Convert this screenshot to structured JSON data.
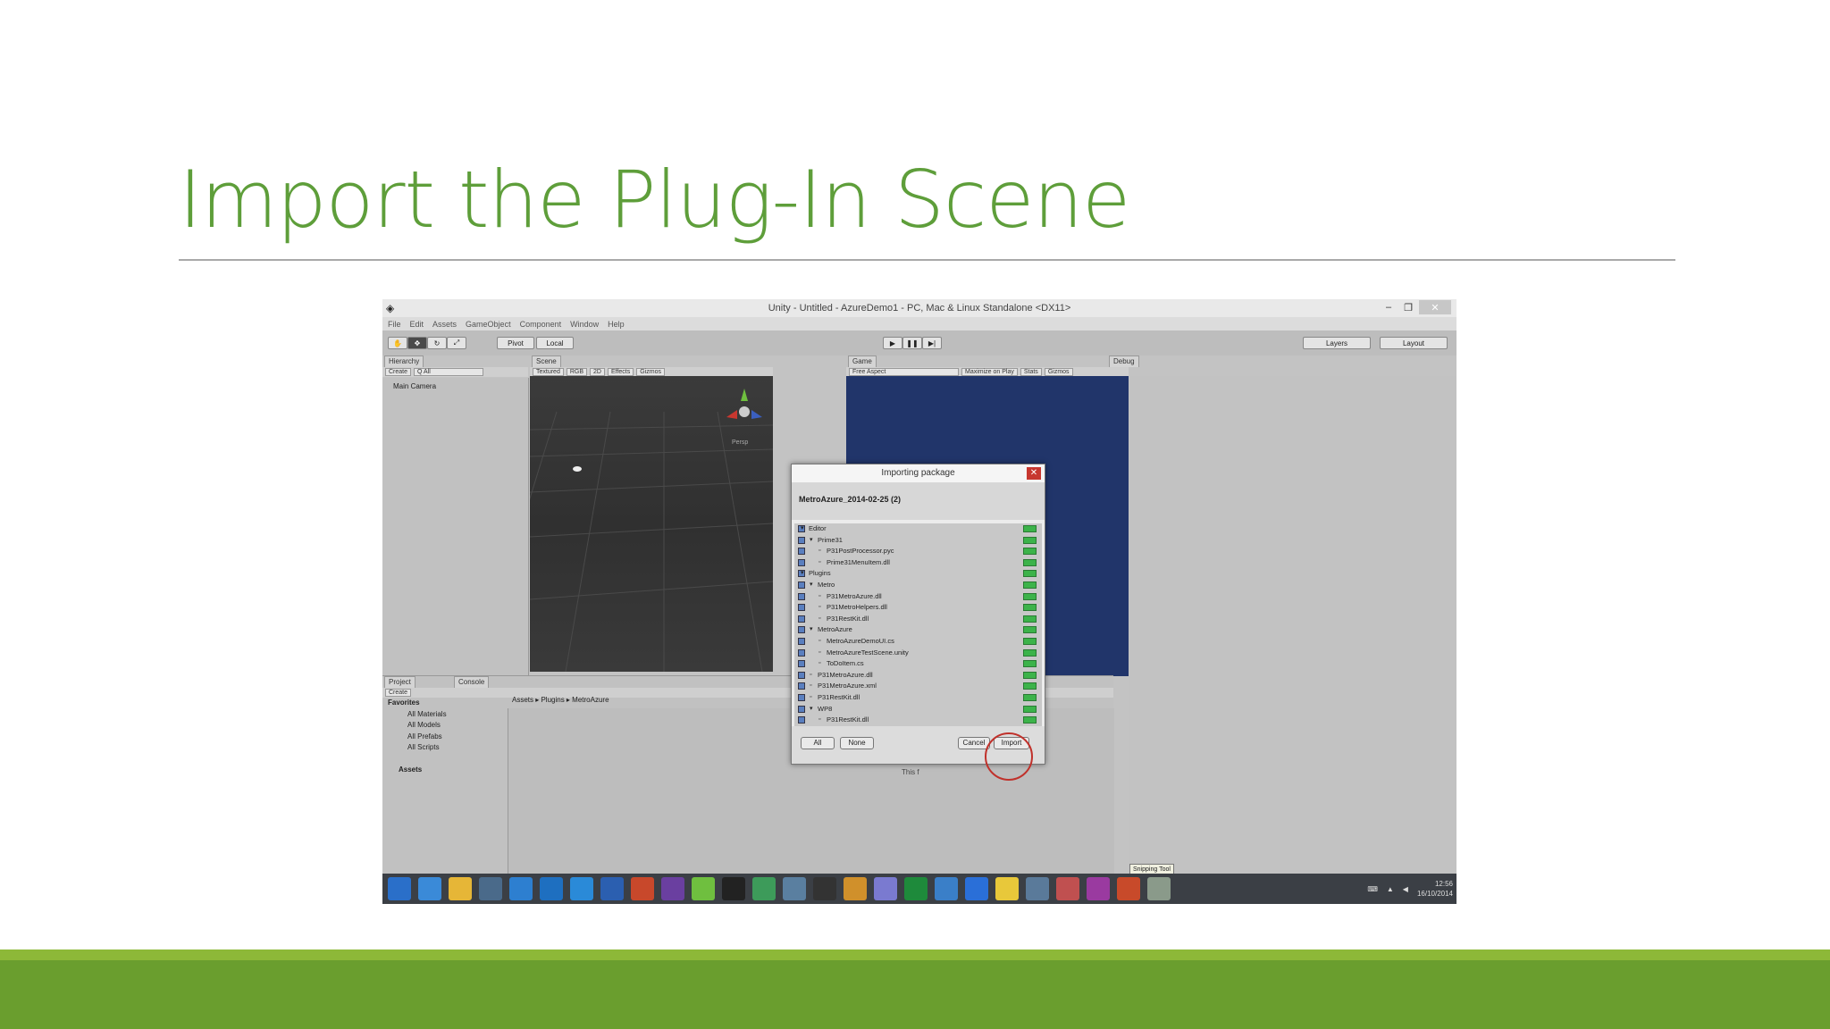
{
  "slide": {
    "title": "Import the Plug-In Scene",
    "accent_color": "#5e9e3a"
  },
  "unity": {
    "window_title": "Unity - Untitled - AzureDemo1 - PC, Mac & Linux Standalone <DX11>",
    "menu": [
      "File",
      "Edit",
      "Assets",
      "GameObject",
      "Component",
      "Window",
      "Help"
    ],
    "toolbar": {
      "pivot": "Pivot",
      "local": "Local",
      "layers": "Layers",
      "layout": "Layout"
    },
    "hierarchy": {
      "tab": "Hierarchy",
      "create": "Create",
      "search": "Q All",
      "items": [
        "Main Camera"
      ]
    },
    "scene": {
      "tab": "Scene",
      "shading": "Textured",
      "rgb": "RGB",
      "mode2d": "2D",
      "effects": "Effects",
      "gizmos": "Gizmos",
      "persp": "Persp"
    },
    "game": {
      "tab": "Game",
      "aspect": "Free Aspect",
      "maximize": "Maximize on Play",
      "stats": "Stats",
      "gizmos": "Gizmos"
    },
    "debug": {
      "tab": "Debug"
    },
    "project": {
      "tab_project": "Project",
      "tab_console": "Console",
      "create": "Create",
      "favorites": [
        "Favorites",
        "All Materials",
        "All Models",
        "All Prefabs",
        "All Scripts"
      ],
      "assets": "Assets",
      "breadcrumb": "Assets ▸ Plugins ▸ MetroAzure",
      "empty_text": "This f"
    },
    "dialog": {
      "title": "Importing package",
      "package": "MetroAzure_2014-02-25 (2)",
      "items": [
        {
          "label": "Editor",
          "indent": 0,
          "folder": true
        },
        {
          "label": "Prime31",
          "indent": 1,
          "folder": true
        },
        {
          "label": "P31PostProcessor.pyc",
          "indent": 2,
          "folder": false
        },
        {
          "label": "Prime31MenuItem.dll",
          "indent": 2,
          "folder": false
        },
        {
          "label": "Plugins",
          "indent": 0,
          "folder": true
        },
        {
          "label": "Metro",
          "indent": 1,
          "folder": true
        },
        {
          "label": "P31MetroAzure.dll",
          "indent": 2,
          "folder": false
        },
        {
          "label": "P31MetroHelpers.dll",
          "indent": 2,
          "folder": false
        },
        {
          "label": "P31RestKit.dll",
          "indent": 2,
          "folder": false
        },
        {
          "label": "MetroAzure",
          "indent": 1,
          "folder": true
        },
        {
          "label": "MetroAzureDemoUI.cs",
          "indent": 2,
          "folder": false
        },
        {
          "label": "MetroAzureTestScene.unity",
          "indent": 2,
          "folder": false
        },
        {
          "label": "ToDoItem.cs",
          "indent": 2,
          "folder": false
        },
        {
          "label": "P31MetroAzure.dll",
          "indent": 1,
          "folder": false
        },
        {
          "label": "P31MetroAzure.xml",
          "indent": 1,
          "folder": false
        },
        {
          "label": "P31RestKit.dll",
          "indent": 1,
          "folder": false
        },
        {
          "label": "WP8",
          "indent": 1,
          "folder": true
        },
        {
          "label": "P31RestKit.dll",
          "indent": 2,
          "folder": false
        }
      ],
      "btn_all": "All",
      "btn_none": "None",
      "btn_cancel": "Cancel",
      "btn_import": "Import",
      "new_badge_color": "#3cb34a",
      "highlight_color": "#c0312b"
    },
    "taskbar": {
      "icons": [
        "windows-start",
        "desktop",
        "file-explorer",
        "browser",
        "internet-explorer",
        "outlook",
        "lync",
        "word",
        "powerpoint",
        "visual-studio",
        "android",
        "terminal",
        "app",
        "app",
        "phone",
        "people",
        "browser",
        "excel",
        "yammer",
        "x-app",
        "unity",
        "network",
        "snipping-tool",
        "onenote",
        "chrome",
        "app"
      ],
      "tooltip": "Snipping Tool",
      "time": "12:56",
      "date": "16/10/2014"
    }
  }
}
